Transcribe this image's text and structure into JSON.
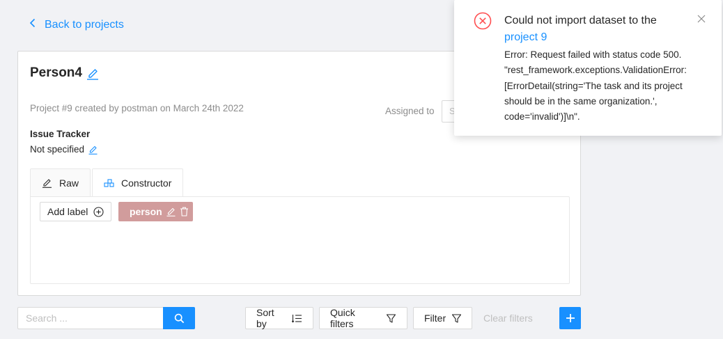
{
  "back_link": {
    "label": "Back to projects",
    "icon": "chevron-left-icon"
  },
  "project": {
    "title": "Person4",
    "meta": "Project #9 created by postman on March 24th 2022",
    "assigned_to_label": "Assigned to",
    "assignee_placeholder": "S",
    "issue_tracker_label": "Issue Tracker",
    "issue_tracker_value": "Not specified"
  },
  "tabs": [
    {
      "label": "Raw",
      "icon": "edit-icon"
    },
    {
      "label": "Constructor",
      "icon": "blocks-icon"
    }
  ],
  "constructor": {
    "add_label": "Add label",
    "labels": [
      {
        "name": "person",
        "color": "#d19c9c"
      }
    ]
  },
  "toolbar": {
    "search_placeholder": "Search ...",
    "sort_by": "Sort by",
    "quick_filters": "Quick filters",
    "filter": "Filter",
    "clear_filters": "Clear filters"
  },
  "notification": {
    "title_prefix": "Could not import dataset to the",
    "project_link": "project 9",
    "description": "Error: Request failed with status code 500.\n\"rest_framework.exceptions.ValidationError:\n[ErrorDetail(string='The task and its project\nshould be in the same organization.',\ncode='invalid')]\\n\"."
  },
  "colors": {
    "accent": "#1890ff",
    "error": "#ff4d4f",
    "label_person": "#d19c9c",
    "background": "#f1f2f5"
  }
}
